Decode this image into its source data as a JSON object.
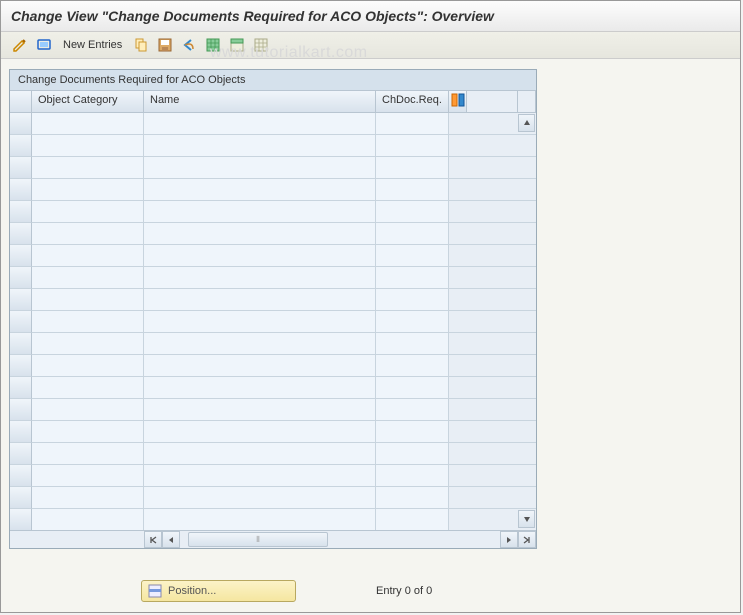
{
  "window": {
    "title": "Change View \"Change Documents Required for ACO Objects\": Overview"
  },
  "toolbar": {
    "new_entries": "New Entries"
  },
  "watermark": "www.tutorialkart.com",
  "table": {
    "title": "Change Documents Required for ACO Objects",
    "columns": {
      "col1": "Object Category",
      "col2": "Name",
      "col3": "ChDoc.Req."
    },
    "row_count": 19
  },
  "footer": {
    "position_label": "Position...",
    "entry_text": "Entry 0 of 0"
  }
}
